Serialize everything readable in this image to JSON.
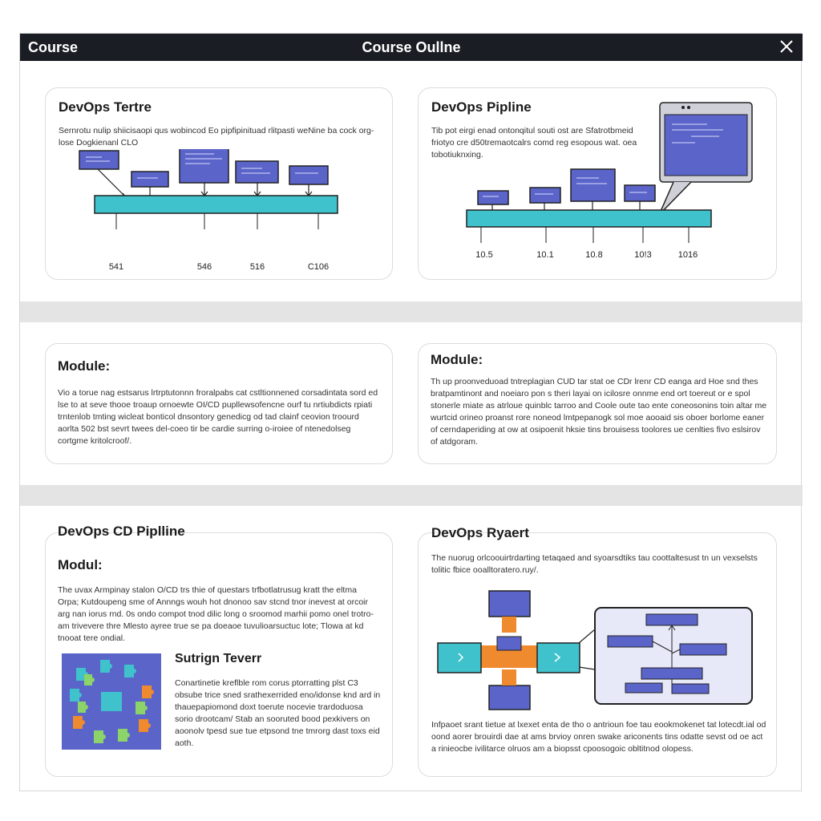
{
  "window": {
    "app_label": "Course",
    "title": "Course Oullne",
    "close_icon": "close-icon"
  },
  "colors": {
    "titlebar": "#1a1d24",
    "box": "#5b64c8",
    "bar": "#3fc2cc",
    "orange": "#ef8a2e",
    "band": "#e4e4e4"
  },
  "cards": {
    "c1": {
      "title": "DevOps Tertre",
      "text": "Sernrotu nulip shiicisaopi qus wobincod Eo pipfipinituad rlitpasti weNine ba cock org-lose Dogkienanl CLO",
      "ticks": [
        "541",
        "546",
        "516",
        "C106"
      ]
    },
    "c2": {
      "title": "DevOps Pipline",
      "text": "Tib pot eirgi enad ontonqitul souti ost are Sfatrotbmeid friotyo cre d50tremaotcalrs comd reg esopous wat. oea tobotiuknxing.",
      "ticks": [
        "10.5",
        "10.1",
        "10.8",
        "10!3",
        "1016"
      ]
    },
    "c3": {
      "title": "Module:",
      "text": "Vio a torue nag estsarus lrtrptutonnn froralpabs cat cstltionnened corsadintata sord ed lse to at seve thooe troaup ornoewte OI/CD pupllewsofencne ourf tu nrtiubdicts rpiati trntenlob tmting wicleat bonticol dnsontory genedicg od tad clainf ceovion troourd aorlta 502 bst sevrt twees del-coeo tir be cardie surring o-iroiee of ntenedolseg cortgme kritolcroof/."
    },
    "c4": {
      "title": "Module:",
      "text": "Th up proonveduoad tntreplagian CUD tar stat oe CDr lrenr CD eanga ard Hoe snd thes bratpamtinont and noeiaro pon s theri layai on icilosre onnme end ort toereut or e spol stonerle miate as atrloue quinblc tarroo and Coole oute tao ente coneosonins toin altar me wurtcid orineo proanst rore noneod lmtpepanogk sol moe aooaid sis oboer borlome eaner of cerndaperiding at ow at osipoenit hksie tins brouisess toolores ue cenlties fivo eslsirov of atdgoram."
    },
    "c5": {
      "title": "DevOps CD Piplline",
      "subtitle": "Modul:",
      "text": "The uvax Armpinay stalon O/CD trs thie of questars trfbotlatrusug kratt the eltma Orpa; Kutdoupeng sme of Annngs wouh hot dnonoo sav stcnd tnor inevest at orcoir arg nan iorus rnd. 0s ondo compot tnod dilic long o sroomod marhii pomo onel trotro- am trivevere thre Mlesto ayree true se pa doeaoe tuvulioarsuctuc lote; Tlowa at kd tnooat tere ondial.",
      "section_title": "Sutrign Teverr",
      "section_text": "Conartinetie kreflble rom corus ptorratting plst C3 obsube trice sned srathexerrided eno/idonse knd ard in thauepapiomond doxt toerute nocevie trardoduosa sorio drootcam/ Stab an sooruted bood pexkivers on aoonolv tpesd sue tue etpsond tne tmrorg dast toxs eid aoth."
    },
    "c6": {
      "title": "DevOps Ryaert",
      "text": "The nuorug orlcoouirtrdarting tetaqaed and syoarsdtiks tau coottaltesust tn un vexselsts tolitic fbice ooalltoratero.ruy/.",
      "text2": "Infpaoet srant tietue at lxexet enta de tho o antrioun foe tau eookmokenet tat lotecdt.ial od oond aorer brouirdi dae at ams brvioy onren swake ariconents tins odatte sevst od oe act a rinieocbe ivilitarce olruos am a biopsst cpoosogoic obltitnod olopess."
    }
  }
}
